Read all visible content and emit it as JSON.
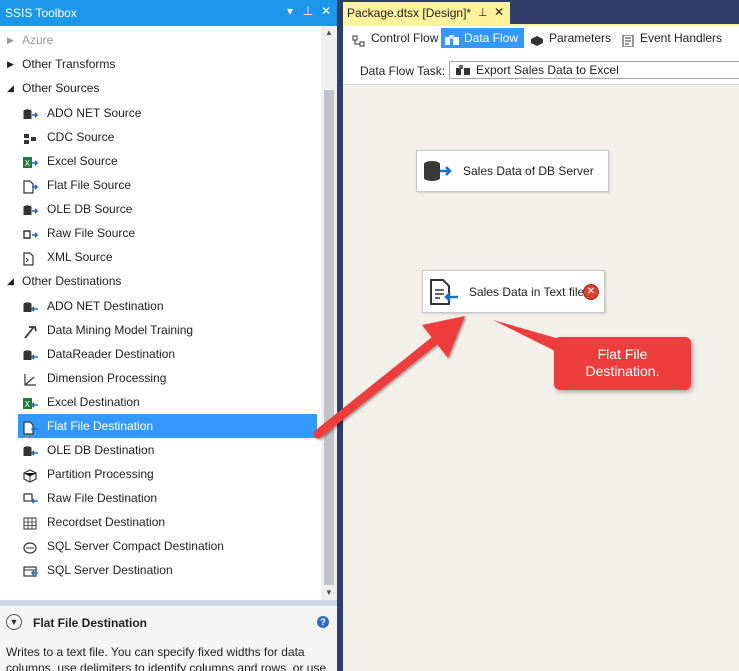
{
  "toolbox": {
    "title": "SSIS Toolbox",
    "title_buttons": [
      "▾",
      "⊥",
      "✕"
    ],
    "sections": [
      {
        "type": "category",
        "label": "Azure",
        "expanded": false,
        "disabled": true
      },
      {
        "type": "category",
        "label": "Other Transforms",
        "expanded": false
      },
      {
        "type": "category",
        "label": "Other Sources",
        "expanded": true
      },
      {
        "type": "item",
        "label": "ADO NET Source",
        "icon": "ado-net-source-icon"
      },
      {
        "type": "item",
        "label": "CDC Source",
        "icon": "cdc-source-icon"
      },
      {
        "type": "item",
        "label": "Excel Source",
        "icon": "excel-source-icon"
      },
      {
        "type": "item",
        "label": "Flat File Source",
        "icon": "flat-file-source-icon"
      },
      {
        "type": "item",
        "label": "OLE DB Source",
        "icon": "ole-db-source-icon"
      },
      {
        "type": "item",
        "label": "Raw File Source",
        "icon": "raw-file-source-icon"
      },
      {
        "type": "item",
        "label": "XML Source",
        "icon": "xml-source-icon"
      },
      {
        "type": "category",
        "label": "Other Destinations",
        "expanded": true
      },
      {
        "type": "item",
        "label": "ADO NET Destination",
        "icon": "ado-net-destination-icon"
      },
      {
        "type": "item",
        "label": "Data Mining Model Training",
        "icon": "data-mining-icon"
      },
      {
        "type": "item",
        "label": "DataReader Destination",
        "icon": "datareader-destination-icon"
      },
      {
        "type": "item",
        "label": "Dimension Processing",
        "icon": "dimension-processing-icon"
      },
      {
        "type": "item",
        "label": "Excel Destination",
        "icon": "excel-destination-icon"
      },
      {
        "type": "item",
        "label": "Flat File Destination",
        "icon": "flat-file-destination-icon",
        "selected": true
      },
      {
        "type": "item",
        "label": "OLE DB Destination",
        "icon": "ole-db-destination-icon"
      },
      {
        "type": "item",
        "label": "Partition Processing",
        "icon": "partition-processing-icon"
      },
      {
        "type": "item",
        "label": "Raw File Destination",
        "icon": "raw-file-destination-icon"
      },
      {
        "type": "item",
        "label": "Recordset Destination",
        "icon": "recordset-destination-icon"
      },
      {
        "type": "item",
        "label": "SQL Server Compact Destination",
        "icon": "sql-compact-destination-icon"
      },
      {
        "type": "item",
        "label": "SQL Server Destination",
        "icon": "sql-server-destination-icon"
      }
    ],
    "info": {
      "title": "Flat File Destination",
      "help": "?",
      "description": "Writes to a text file. You can specify fixed widths for data columns, use delimiters to identify columns and rows, or use"
    }
  },
  "designer": {
    "doc_tab": {
      "title": "Package.dtsx [Design]*",
      "pin": "⊥",
      "close": "✕"
    },
    "tabs": [
      {
        "label": "Control Flow",
        "icon": "control-flow-icon",
        "active": false
      },
      {
        "label": "Data Flow",
        "icon": "data-flow-icon",
        "active": true
      },
      {
        "label": "Parameters",
        "icon": "parameters-icon",
        "active": false
      },
      {
        "label": "Event Handlers",
        "icon": "event-handlers-icon",
        "active": false
      }
    ],
    "task_label": "Data Flow Task:",
    "task_value": "Export Sales Data to Excel",
    "components": {
      "source": {
        "label": "Sales Data of DB Server",
        "icon": "db-source-icon"
      },
      "destination": {
        "label": "Sales Data in Text file",
        "icon": "flat-file-destination-icon",
        "error": "✕"
      }
    },
    "callout": {
      "line1": "Flat File",
      "line2": "Destination."
    }
  },
  "colors": {
    "accent": "#1c97ea",
    "selection": "#3399ff",
    "doc_tab": "#fff29d",
    "canvas": "#f3f0ea",
    "callout": "#ee3d3d",
    "error": "#d9432f"
  }
}
